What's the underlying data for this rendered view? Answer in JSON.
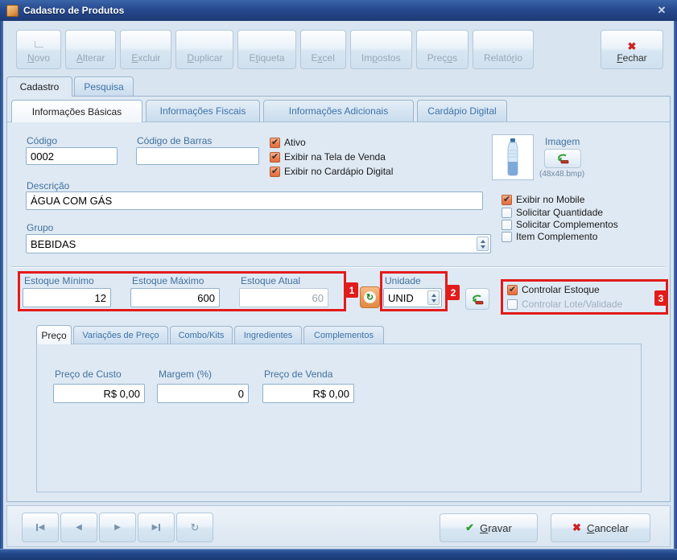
{
  "window": {
    "title": "Cadastro de Produtos",
    "close_glyph": "✕"
  },
  "toolbar": {
    "buttons": [
      {
        "pre": "",
        "key": "N",
        "post": "ovo"
      },
      {
        "pre": "",
        "key": "A",
        "post": "lterar"
      },
      {
        "pre": "",
        "key": "E",
        "post": "xcluir"
      },
      {
        "pre": "",
        "key": "D",
        "post": "uplicar"
      },
      {
        "pre": "E",
        "key": "t",
        "post": "iqueta"
      },
      {
        "pre": "E",
        "key": "x",
        "post": "cel"
      },
      {
        "pre": "Im",
        "key": "p",
        "post": "ostos"
      },
      {
        "pre": "Preç",
        "key": "o",
        "post": "s"
      },
      {
        "pre": "Relató",
        "key": "r",
        "post": "io"
      }
    ],
    "fechar": {
      "pre": "",
      "key": "F",
      "post": "echar",
      "icon": "✖"
    }
  },
  "tabs": {
    "main": [
      {
        "label": "Cadastro"
      },
      {
        "label": "Pesquisa"
      }
    ],
    "info": [
      {
        "label": "Informações Básicas"
      },
      {
        "label": "Informações Fiscais"
      },
      {
        "label": "Informações Adicionais"
      },
      {
        "label": "Cardápio Digital"
      }
    ]
  },
  "form": {
    "codigo": {
      "label": "Código",
      "value": "0002"
    },
    "codigo_barras": {
      "label": "Código de Barras",
      "value": ""
    },
    "flags_top": [
      {
        "label": "Ativo",
        "checked": true
      },
      {
        "label": "Exibir na Tela de Venda",
        "checked": true
      },
      {
        "label": "Exibir no Cardápio Digital",
        "checked": true
      }
    ],
    "imagem": {
      "label": "Imagem",
      "caption": "(48x48.bmp)"
    },
    "descricao": {
      "label": "Descrição",
      "value": "ÁGUA COM GÁS"
    },
    "flags_right": [
      {
        "label": "Exibir no Mobile",
        "checked": true
      },
      {
        "label": "Solicitar Quantidade",
        "checked": false
      },
      {
        "label": "Solicitar Complementos",
        "checked": false
      },
      {
        "label": "Item Complemento",
        "checked": false
      }
    ],
    "grupo": {
      "label": "Grupo",
      "value": "BEBIDAS"
    },
    "estoque": {
      "minimo": {
        "label": "Estoque Mínimo",
        "value": "12"
      },
      "maximo": {
        "label": "Estoque Máximo",
        "value": "600"
      },
      "atual": {
        "label": "Estoque Atual",
        "value": "60"
      }
    },
    "unidade": {
      "label": "Unidade",
      "value": "UNID"
    },
    "controlar": [
      {
        "label": "Controlar Estoque",
        "checked": true,
        "disabled": false
      },
      {
        "label": "Controlar Lote/Validade",
        "checked": false,
        "disabled": true
      }
    ],
    "annotations": [
      "1",
      "2",
      "3"
    ]
  },
  "price": {
    "tabs": [
      {
        "label": "Preço"
      },
      {
        "label": "Variações de Preço"
      },
      {
        "label": "Combo/Kits"
      },
      {
        "label": "Ingredientes"
      },
      {
        "label": "Complementos"
      }
    ],
    "custo": {
      "label": "Preço de Custo",
      "value": "R$ 0,00"
    },
    "margem": {
      "label": "Margem (%)",
      "value": "0"
    },
    "venda": {
      "label": "Preço de Venda",
      "value": "R$ 0,00"
    }
  },
  "footer": {
    "nav": [
      {
        "name": "first",
        "glyph": "◀"
      },
      {
        "name": "prev",
        "glyph": "◀"
      },
      {
        "name": "next",
        "glyph": "▶"
      },
      {
        "name": "last",
        "glyph": "▶"
      },
      {
        "name": "refresh",
        "glyph": "↻"
      }
    ],
    "gravar": {
      "pre": "",
      "key": "G",
      "post": "ravar",
      "icon": "✔"
    },
    "cancelar": {
      "pre": "",
      "key": "C",
      "post": "ancelar",
      "icon": "✖"
    }
  }
}
